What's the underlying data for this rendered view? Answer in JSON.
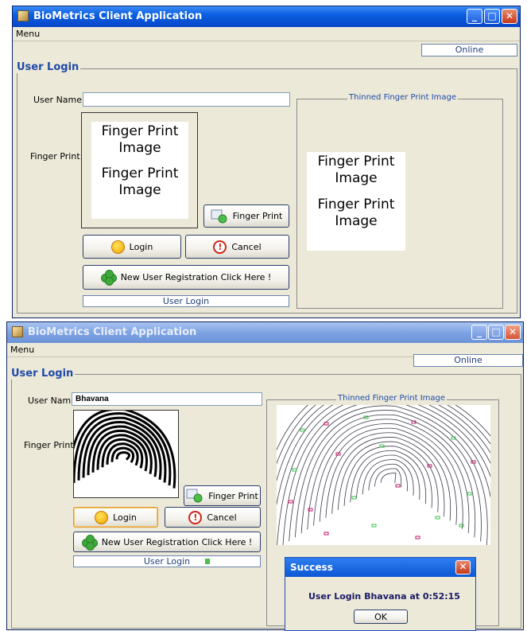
{
  "app": {
    "title": "BioMetrics Client Application",
    "menu_label": "Menu",
    "status": "Online"
  },
  "form": {
    "group_title": "User Login",
    "user_name_label": "User Name:",
    "fingerprint_label": "Finger Print:",
    "thinned_title": "Thinned Finger Print Image",
    "placeholder_line1": "Finger Print",
    "placeholder_line2": "Image",
    "fingerprint_button": "Finger Print",
    "login_button": "Login",
    "cancel_button": "Cancel",
    "registration_button": "New User Registration Click Here !",
    "progress_label": "User Login"
  },
  "screen2": {
    "user_name_value": "Bhavana",
    "progress_fill": 0.16
  },
  "dialog": {
    "title": "Success",
    "message": "User Login Bhavana at 0:52:15",
    "ok_button": "OK"
  },
  "colors": {
    "titlebar_active": "#0a5fe0",
    "titlebar_inactive": "#7ea3e3",
    "legend": "#1f4aa8",
    "progress_fill": "#4cbf4a",
    "minutiae_green": "#3fbf4f",
    "minutiae_magenta": "#c2186b"
  },
  "icons": {
    "window": "app-window-icon",
    "login": "smiley-icon",
    "cancel": "stop-icon",
    "registration": "clover-icon",
    "fingerprint": "fingerprint-scanner-icon"
  }
}
